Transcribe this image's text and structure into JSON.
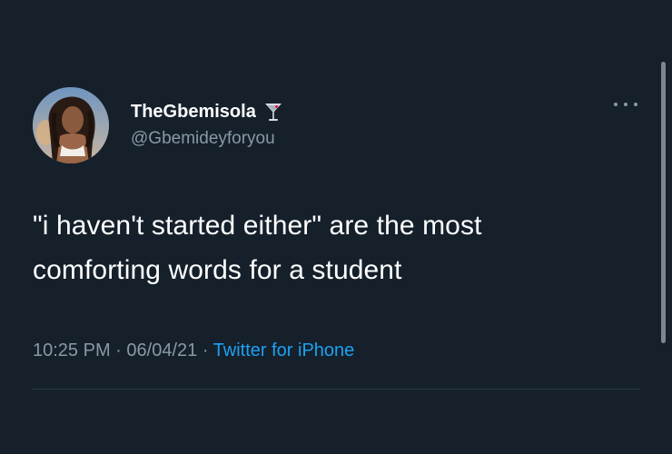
{
  "tweet": {
    "author": {
      "display_name": "TheGbemisola",
      "handle": "@Gbemideyforyou",
      "name_emoji": "cocktail-glass-icon"
    },
    "text": "\"i haven't started either\" are the most comforting words for a student",
    "time": "10:25 PM",
    "date": "06/04/21",
    "source": "Twitter for iPhone",
    "separator": "·"
  },
  "colors": {
    "background": "#15202b",
    "primary_text": "#ffffff",
    "secondary_text": "#8899a6",
    "link": "#1da1f2"
  },
  "icons": {
    "more": "more-options-icon"
  }
}
